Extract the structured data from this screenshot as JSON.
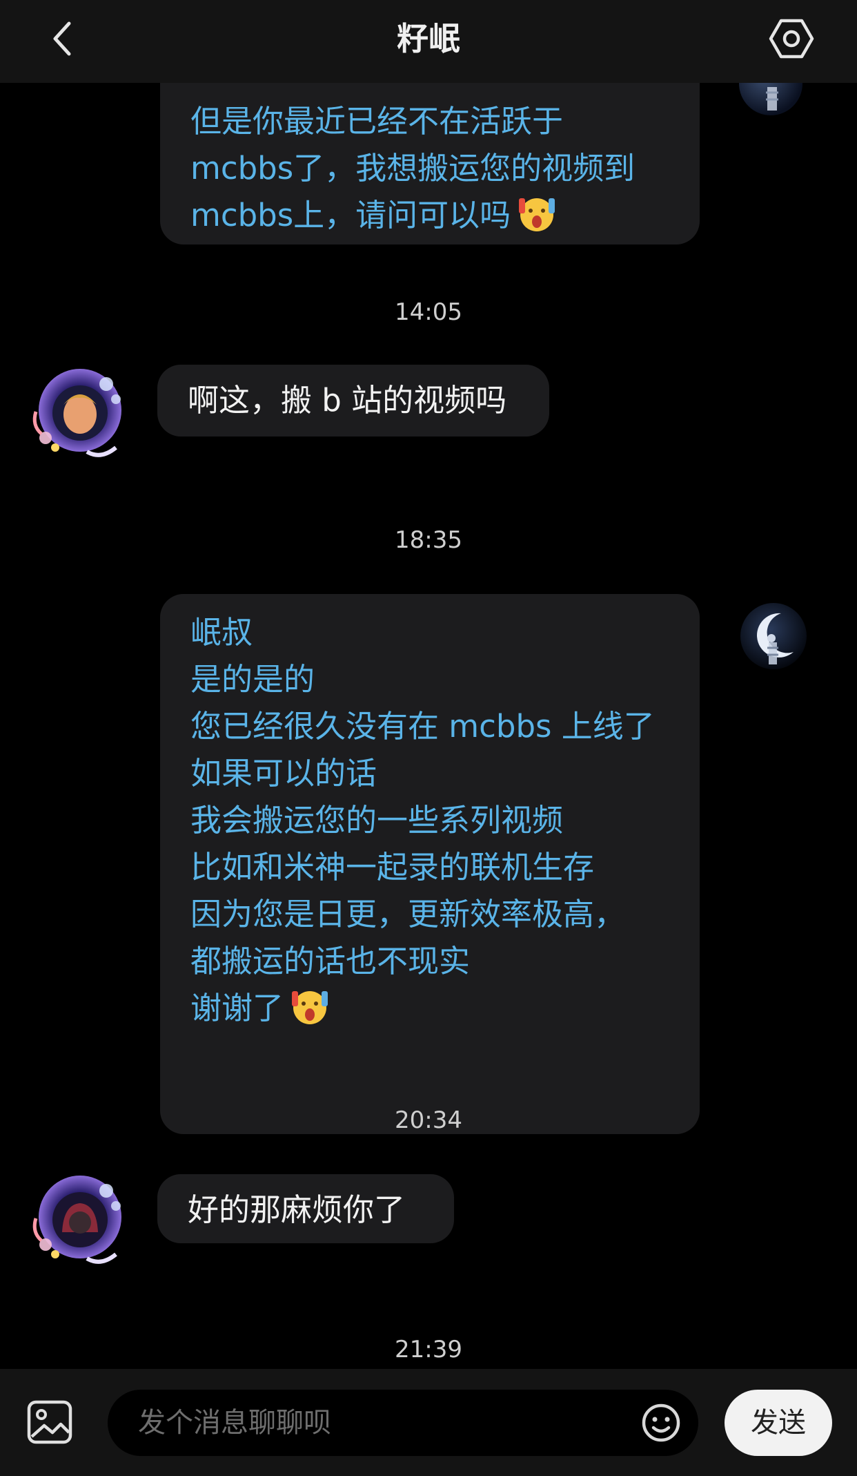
{
  "header": {
    "title": "籽岷",
    "back_icon": "chevron-left-icon",
    "settings_icon": "hexagon-settings-icon"
  },
  "messages": [
    {
      "sender": "me",
      "lines": [
        "但是你最近已经不在活跃于",
        "mcbbs了，我想搬运您的视频到",
        "mcbbs上，请问可以吗"
      ],
      "emoji": "surprised-face-emoji"
    },
    {
      "type": "time",
      "text": "14:05"
    },
    {
      "sender": "other",
      "lines": [
        "啊这，搬 b 站的视频吗"
      ]
    },
    {
      "type": "time",
      "text": "18:35"
    },
    {
      "sender": "me",
      "lines": [
        "岷叔",
        "是的是的",
        "您已经很久没有在 mcbbs 上线了",
        "如果可以的话",
        "我会搬运您的一些系列视频",
        "比如和米神一起录的联机生存",
        "因为您是日更，更新效率极高，",
        "都搬运的话也不现实",
        "谢谢了"
      ],
      "emoji": "surprised-face-emoji"
    },
    {
      "type": "time",
      "text": "20:34"
    },
    {
      "sender": "other",
      "lines": [
        "好的那麻烦你了"
      ]
    },
    {
      "type": "time",
      "text": "21:39"
    }
  ],
  "composer": {
    "placeholder": "发个消息聊聊呗",
    "send_label": "发送",
    "image_icon": "image-icon",
    "emoji_icon": "smiley-icon"
  },
  "colors": {
    "my_text": "#5ab4e8",
    "their_text": "#f2f2f2",
    "bubble_bg": "#1c1c1e",
    "header_bg": "#141414",
    "page_bg": "#000000"
  }
}
